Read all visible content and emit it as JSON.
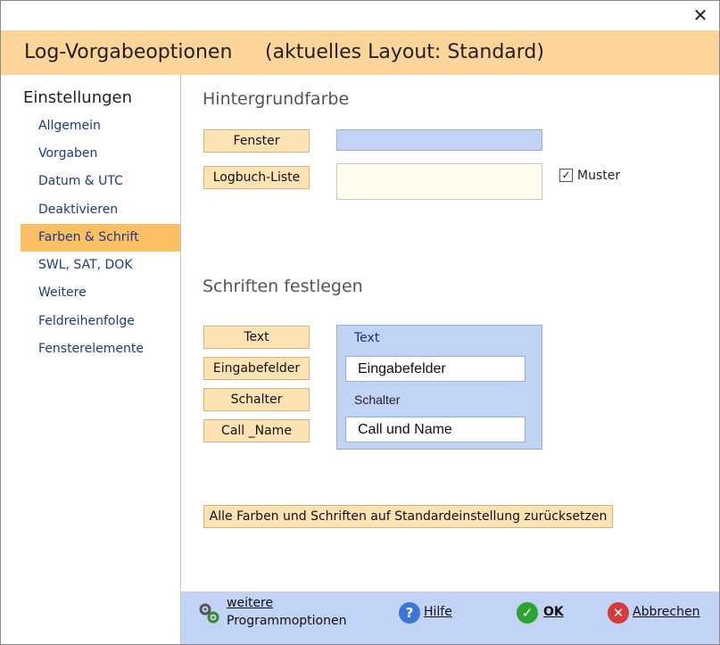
{
  "window": {
    "close_glyph": "✕"
  },
  "title": {
    "text": "Log-Vorgabeoptionen",
    "layout": "(aktuelles Layout: Standard)"
  },
  "sidebar": {
    "heading": "Einstellungen",
    "items": [
      {
        "label": "Allgemein"
      },
      {
        "label": "Vorgaben"
      },
      {
        "label": "Datum & UTC"
      },
      {
        "label": "Deaktivieren"
      },
      {
        "label": "Farben & Schrift",
        "active": true
      },
      {
        "label": "SWL, SAT, DOK"
      },
      {
        "label": "Weitere"
      },
      {
        "label": "Feldreihenfolge"
      },
      {
        "label": "Fensterelemente"
      }
    ]
  },
  "background": {
    "title": "Hintergrundfarbe",
    "fenster_label": "Fenster",
    "fenster_color": "#c2d4f5",
    "logbuch_label": "Logbuch-Liste",
    "logbuch_color": "#fffdee",
    "muster_label": "Muster",
    "muster_checked": true
  },
  "fonts": {
    "title": "Schriften festlegen",
    "buttons": {
      "text": "Text",
      "eingabe": "Eingabefelder",
      "schalter": "Schalter",
      "call": "Call _Name"
    },
    "preview": {
      "text": "Text",
      "eingabe": "Eingabefelder",
      "schalter": "Schalter",
      "call": "Call und Name"
    }
  },
  "reset_label": "Alle Farben und Schriften auf Standardeinstellung zurücksetzen",
  "footer": {
    "options_line1": "weitere",
    "options_line2": "Programmoptionen",
    "help": "Hilfe",
    "ok": "OK",
    "cancel": "Abbrechen"
  },
  "colors": {
    "accent": "#fdd49a",
    "active": "#fdbf64",
    "footer": "#c2d4f5"
  },
  "icons": {
    "options": "gears-icon",
    "help": "question-icon",
    "ok": "check-icon",
    "cancel": "x-icon"
  }
}
